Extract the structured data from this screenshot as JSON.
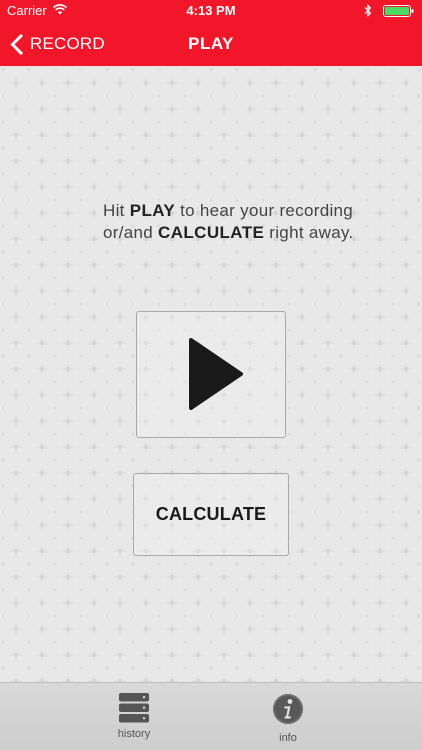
{
  "status_bar": {
    "carrier": "Carrier",
    "time": "4:13 PM"
  },
  "nav": {
    "back_label": "RECORD",
    "title": "PLAY"
  },
  "content": {
    "instructions": {
      "part1": "Hit ",
      "play_keyword": "PLAY",
      "part2": " to hear your recording or/and ",
      "calculate_keyword": "CALCULATE",
      "part3": " right away."
    },
    "calculate_label": "CALCULATE"
  },
  "tabs": [
    {
      "label": "history",
      "icon": "database-stack-icon"
    },
    {
      "label": "info",
      "icon": "info-circle-icon"
    }
  ],
  "colors": {
    "header": "#f2162b",
    "play_icon": "#1a1a1a",
    "battery": "#4cd964"
  }
}
